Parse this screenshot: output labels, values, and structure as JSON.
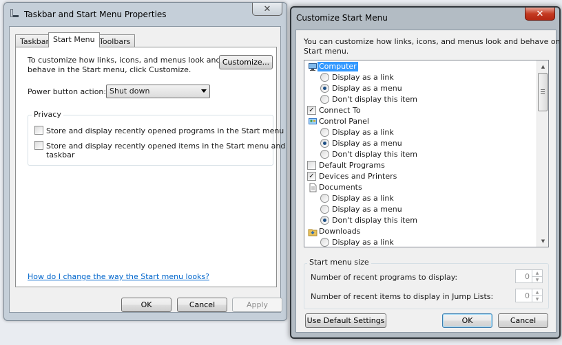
{
  "taskbar_dialog": {
    "title": "Taskbar and Start Menu Properties",
    "tabs": [
      "Taskbar",
      "Start Menu",
      "Toolbars"
    ],
    "active_tab": "Start Menu",
    "intro_line1": "To customize how links, icons, and menus look and",
    "intro_line2": "behave in the Start menu, click Customize.",
    "customize_label": "Customize...",
    "power_label": "Power button action:",
    "power_value": "Shut down",
    "privacy_label": "Privacy",
    "privacy_opt1": "Store and display recently opened programs in the Start menu",
    "privacy_opt2_line1": "Store and display recently opened items in the Start menu and the",
    "privacy_opt2_line2": "taskbar",
    "help_link": "How do I change the way the Start menu looks?",
    "ok": "OK",
    "cancel": "Cancel",
    "apply": "Apply"
  },
  "customize_dialog": {
    "title": "Customize Start Menu",
    "intro_line1": "You can customize how links, icons, and menus look and behave on the",
    "intro_line2": "Start menu.",
    "items": [
      {
        "label": "Computer",
        "kind": "header-selected",
        "icon": "computer-icon"
      },
      {
        "label": "Display as a link",
        "kind": "radio",
        "checked": false
      },
      {
        "label": "Display as a menu",
        "kind": "radio",
        "checked": true
      },
      {
        "label": "Don't display this item",
        "kind": "radio",
        "checked": false
      },
      {
        "label": "Connect To",
        "kind": "checkbox",
        "checked": true
      },
      {
        "label": "Control Panel",
        "kind": "header",
        "icon": "control-panel-icon"
      },
      {
        "label": "Display as a link",
        "kind": "radio",
        "checked": false
      },
      {
        "label": "Display as a menu",
        "kind": "radio",
        "checked": true
      },
      {
        "label": "Don't display this item",
        "kind": "radio",
        "checked": false
      },
      {
        "label": "Default Programs",
        "kind": "checkbox",
        "checked": false
      },
      {
        "label": "Devices and Printers",
        "kind": "checkbox",
        "checked": true
      },
      {
        "label": "Documents",
        "kind": "header",
        "icon": "documents-icon"
      },
      {
        "label": "Display as a link",
        "kind": "radio",
        "checked": false
      },
      {
        "label": "Display as a menu",
        "kind": "radio",
        "checked": false
      },
      {
        "label": "Don't display this item",
        "kind": "radio",
        "checked": true
      },
      {
        "label": "Downloads",
        "kind": "header",
        "icon": "downloads-icon"
      },
      {
        "label": "Display as a link",
        "kind": "radio",
        "checked": false
      }
    ],
    "size_group_label": "Start menu size",
    "recent_programs_label": "Number of recent programs to display:",
    "recent_programs_value": "0",
    "recent_items_label": "Number of recent items to display in Jump Lists:",
    "recent_items_value": "0",
    "use_default": "Use Default Settings",
    "ok": "OK",
    "cancel": "Cancel"
  }
}
